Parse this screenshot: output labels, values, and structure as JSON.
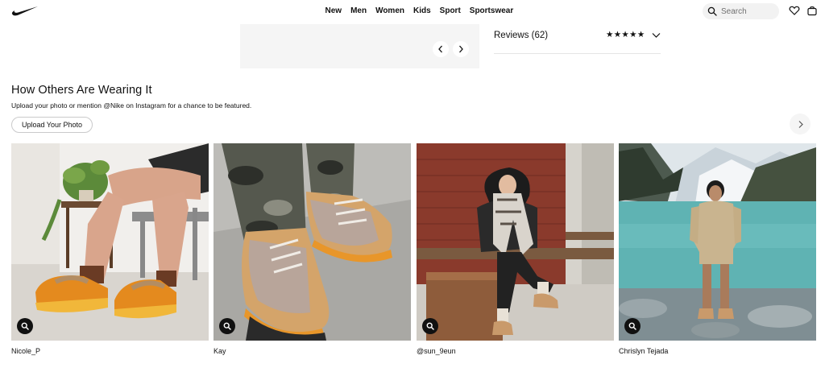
{
  "header": {
    "nav": [
      "New",
      "Men",
      "Women",
      "Kids",
      "Sport",
      "Sportswear"
    ],
    "search_placeholder": "Search",
    "logo_icon": "swoosh-logo",
    "favorites_icon": "heart-icon",
    "bag_icon": "bag-icon"
  },
  "gallery": {
    "prev_icon": "chevron-left-icon",
    "next_icon": "chevron-right-icon"
  },
  "reviews": {
    "label": "Reviews (62)",
    "stars": "★★★★★",
    "rating_stars": 5,
    "expand_icon": "chevron-down-icon"
  },
  "ugc": {
    "title": "How Others Are Wearing It",
    "subtitle": "Upload your photo or mention @Nike on Instagram for a chance to be featured.",
    "upload_label": "Upload Your Photo",
    "next_icon": "chevron-right-icon",
    "photos": [
      {
        "caption": "Nicole_P"
      },
      {
        "caption": "Kay"
      },
      {
        "caption": "@sun_9eun"
      },
      {
        "caption": "Chrislyn Tejada"
      }
    ]
  },
  "colors": {
    "text": "#111111",
    "panel": "#f5f5f5",
    "shoe_orange": "#e0891f",
    "lake": "#5fb3b3"
  }
}
